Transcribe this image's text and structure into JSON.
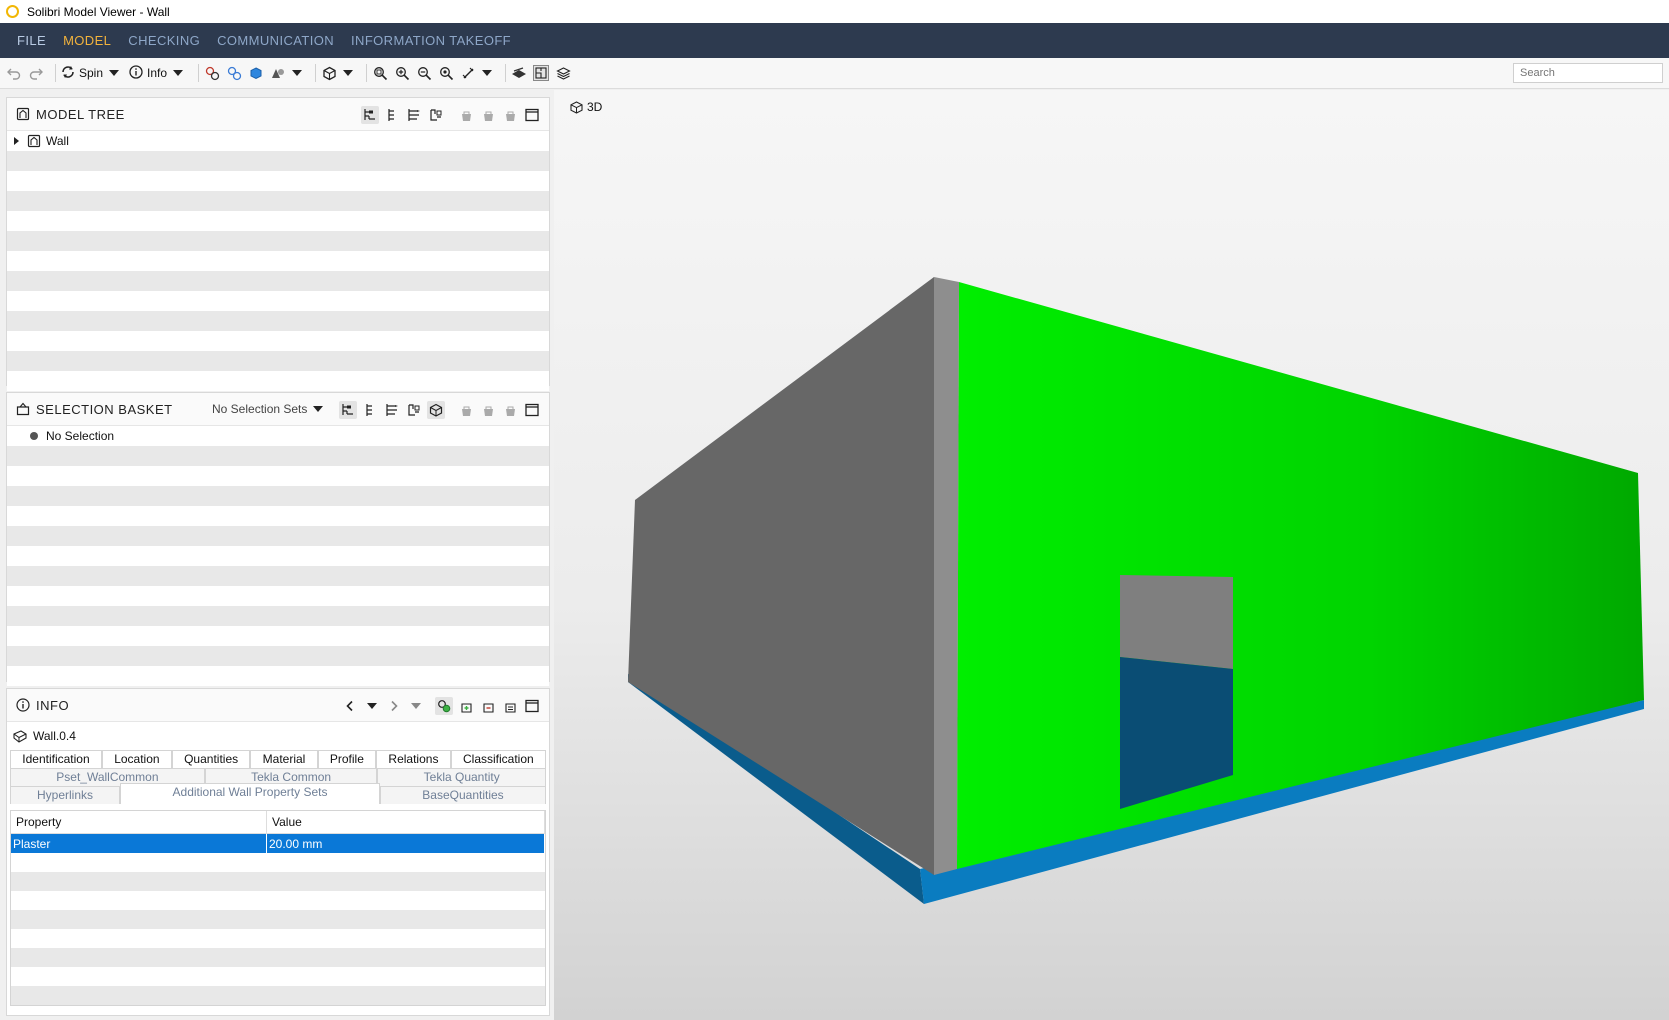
{
  "window": {
    "title": "Solibri Model Viewer - Wall"
  },
  "menu": {
    "items": [
      "FILE",
      "MODEL",
      "CHECKING",
      "COMMUNICATION",
      "INFORMATION TAKEOFF"
    ],
    "active": "MODEL"
  },
  "toolbar": {
    "spin_label": "Spin",
    "info_label": "Info",
    "search_placeholder": "Search"
  },
  "model_tree": {
    "title": "MODEL TREE",
    "root_label": "Wall"
  },
  "selection_basket": {
    "title": "SELECTION BASKET",
    "sets_label": "No Selection Sets",
    "empty_label": "No Selection"
  },
  "info": {
    "title": "INFO",
    "object_name": "Wall.0.4",
    "tabs_row1": [
      "Identification",
      "Location",
      "Quantities",
      "Material",
      "Profile",
      "Relations",
      "Classification"
    ],
    "tabs_row2": [
      "Pset_WallCommon",
      "Tekla Common",
      "Tekla Quantity"
    ],
    "tabs_row3": [
      "Hyperlinks",
      "Additional Wall Property Sets",
      "BaseQuantities"
    ],
    "active_tab": "Additional Wall Property Sets",
    "columns": [
      "Property",
      "Value"
    ],
    "rows": [
      {
        "property": "Plaster",
        "value": "20.00 mm"
      }
    ]
  },
  "view3d": {
    "label": "3D"
  },
  "colors": {
    "accent": "#f2b33d",
    "menubar": "#2d3a4f",
    "selection": "#0a78d7",
    "wall_green": "#00e600",
    "wall_gray": "#6a6a6a",
    "floor_blue": "#0a7cc0"
  }
}
